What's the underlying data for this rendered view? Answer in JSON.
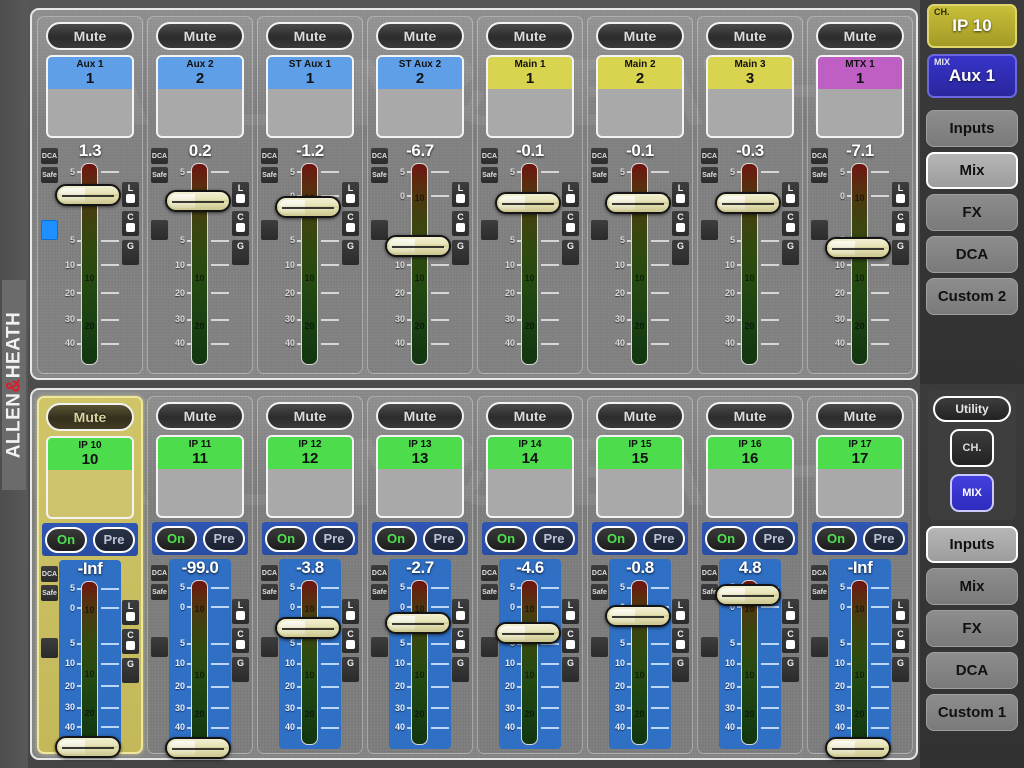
{
  "brand": {
    "name_a": "ALLEN",
    "amp": "&",
    "name_b": "HEATH",
    "watermark": "ALLEN&HEATH"
  },
  "scale": {
    "labels": [
      "5",
      "0",
      "5",
      "10",
      "20",
      "30",
      "40"
    ]
  },
  "meter_marks": {
    "m10": "10",
    "m20": "20"
  },
  "strip_controls": {
    "mute": "Mute",
    "dca": "DCA",
    "safe": "Safe",
    "on": "On",
    "pre": "Pre",
    "lcg": [
      "L",
      "C",
      "G"
    ]
  },
  "top_bank": {
    "strips": [
      {
        "name": "Aux 1",
        "num": "1",
        "color": "#5f9fe8",
        "value": "1.3",
        "knob_pct": 12,
        "selected": false,
        "blue_chip": true
      },
      {
        "name": "Aux 2",
        "num": "2",
        "color": "#5f9fe8",
        "value": "0.2",
        "knob_pct": 15,
        "selected": false,
        "blue_chip": false
      },
      {
        "name": "ST Aux 1",
        "num": "1",
        "color": "#5f9fe8",
        "value": "-1.2",
        "knob_pct": 18,
        "selected": false,
        "blue_chip": false
      },
      {
        "name": "ST Aux 2",
        "num": "2",
        "color": "#5f9fe8",
        "value": "-6.7",
        "knob_pct": 37,
        "selected": false,
        "blue_chip": false
      },
      {
        "name": "Main 1",
        "num": "1",
        "color": "#d9d450",
        "value": "-0.1",
        "knob_pct": 16,
        "selected": false,
        "blue_chip": false
      },
      {
        "name": "Main 2",
        "num": "2",
        "color": "#d9d450",
        "value": "-0.1",
        "knob_pct": 16,
        "selected": false,
        "blue_chip": false
      },
      {
        "name": "Main 3",
        "num": "3",
        "color": "#d9d450",
        "value": "-0.3",
        "knob_pct": 16,
        "selected": false,
        "blue_chip": false
      },
      {
        "name": "MTX 1",
        "num": "1",
        "color": "#bf5fc4",
        "value": "-7.1",
        "knob_pct": 38,
        "selected": false,
        "blue_chip": false
      }
    ]
  },
  "bottom_bank": {
    "strips": [
      {
        "name": "IP 10",
        "num": "10",
        "color": "#4cdc4c",
        "value": "-Inf",
        "knob_pct": 97,
        "selected": true
      },
      {
        "name": "IP 11",
        "num": "11",
        "color": "#4cdc4c",
        "value": "-99.0",
        "knob_pct": 97,
        "selected": false
      },
      {
        "name": "IP 12",
        "num": "12",
        "color": "#4cdc4c",
        "value": "-3.8",
        "knob_pct": 24,
        "selected": false
      },
      {
        "name": "IP 13",
        "num": "13",
        "color": "#4cdc4c",
        "value": "-2.7",
        "knob_pct": 21,
        "selected": false
      },
      {
        "name": "IP 14",
        "num": "14",
        "color": "#4cdc4c",
        "value": "-4.6",
        "knob_pct": 27,
        "selected": false
      },
      {
        "name": "IP 15",
        "num": "15",
        "color": "#4cdc4c",
        "value": "-0.8",
        "knob_pct": 17,
        "selected": false
      },
      {
        "name": "IP 16",
        "num": "16",
        "color": "#4cdc4c",
        "value": "4.8",
        "knob_pct": 4,
        "selected": false
      },
      {
        "name": "IP 17",
        "num": "17",
        "color": "#4cdc4c",
        "value": "-Inf",
        "knob_pct": 97,
        "selected": false
      }
    ]
  },
  "sidebar_top": {
    "ch": {
      "tag": "CH.",
      "value": "IP 10"
    },
    "mix": {
      "tag": "MIX",
      "value": "Aux 1"
    },
    "nav": [
      {
        "label": "Inputs",
        "active": false
      },
      {
        "label": "Mix",
        "active": true
      },
      {
        "label": "FX",
        "active": false
      },
      {
        "label": "DCA",
        "active": false
      },
      {
        "label": "Custom 2",
        "active": false
      }
    ]
  },
  "sidebar_bottom": {
    "mode": {
      "utility": "Utility",
      "ch": "CH.",
      "mix": "MIX",
      "mix_selected": true
    },
    "nav": [
      {
        "label": "Inputs",
        "active": true
      },
      {
        "label": "Mix",
        "active": false
      },
      {
        "label": "FX",
        "active": false
      },
      {
        "label": "DCA",
        "active": false
      },
      {
        "label": "Custom 1",
        "active": false
      }
    ]
  },
  "colors": {
    "aux": "#5f9fe8",
    "main": "#d9d450",
    "mtx": "#bf5fc4",
    "input": "#4cdc4c",
    "selected_strip": "#cfc46d",
    "mix_blue": "#2f56b4",
    "ch_yellow": "#c8bf3a"
  }
}
